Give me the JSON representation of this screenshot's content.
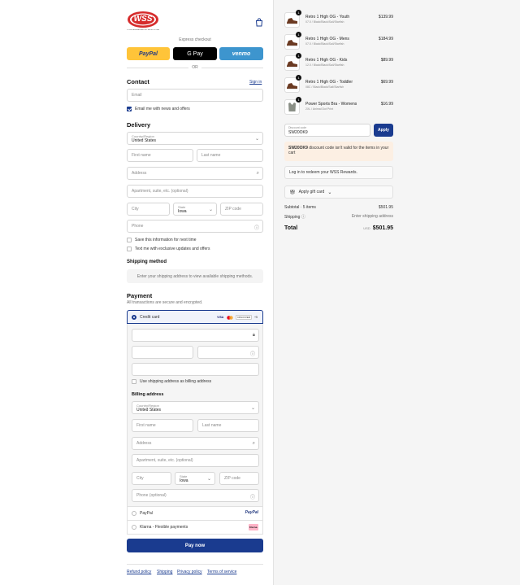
{
  "header": {
    "logo_text": "WSS",
    "logo_tagline": "YOUR NEIGHBORHOOD SHOE STORE"
  },
  "express": {
    "label": "Express checkout",
    "paypal": "PayPal",
    "gpay": "G Pay",
    "venmo": "venmo",
    "or": "OR"
  },
  "contact": {
    "title": "Contact",
    "sign_in": "Sign in",
    "email_placeholder": "Email",
    "news_label": "Email me with news and offers",
    "news_checked": true
  },
  "delivery": {
    "title": "Delivery",
    "country_label": "Country/Region",
    "country_value": "United States",
    "first_name": "First name",
    "last_name": "Last name",
    "address": "Address",
    "apartment": "Apartment, suite, etc. (optional)",
    "city": "City",
    "state_label": "State",
    "state_value": "Iowa",
    "zip": "ZIP code",
    "phone": "Phone",
    "save_info": "Save this information for next time",
    "text_me": "Text me with exclusive updates and offers"
  },
  "shipping": {
    "title": "Shipping method",
    "placeholder": "Enter your shipping address to view available shipping methods."
  },
  "payment": {
    "title": "Payment",
    "subtitle": "All transactions are secure and encrypted.",
    "credit_card": "Credit card",
    "card_brands": [
      "VISA",
      "MC",
      "DISCOVER",
      "+5"
    ],
    "use_shipping": "Use shipping address as billing address",
    "paypal": "PayPal",
    "klarna": "Klarna - Flexible payments",
    "klarna_badge": "Klarna."
  },
  "billing": {
    "title": "Billing address",
    "country_label": "Country/Region",
    "country_value": "United States",
    "first_name": "First name",
    "last_name": "Last name",
    "address": "Address",
    "apartment": "Apartment, suite, etc. (optional)",
    "city": "City",
    "state_label": "State",
    "state_value": "Iowa",
    "zip": "ZIP code",
    "phone": "Phone (optional)"
  },
  "pay_now": "Pay now",
  "footer": {
    "refund": "Refund policy",
    "shipping": "Shipping",
    "privacy": "Privacy policy",
    "terms": "Terms of service"
  },
  "cart": {
    "items": [
      {
        "name": "Retro 1 High OG - Youth",
        "variant": "07.0 / Black/Black/Sail/Starfish",
        "price": "$139.99",
        "qty": "1"
      },
      {
        "name": "Retro 1 High OG - Mens",
        "variant": "07.0 / Black/Black/Sail/Starfish",
        "price": "$184.99",
        "qty": "1"
      },
      {
        "name": "Retro 1 High OG - Kids",
        "variant": "12.0 / Black/Black/Sail/Starfish",
        "price": "$89.99",
        "qty": "1"
      },
      {
        "name": "Retro 1 High OG - Toddler",
        "variant": "08C / Black/Black/Sail/Starfish",
        "price": "$69.99",
        "qty": "1"
      },
      {
        "name": "Power Sports Bra - Womens",
        "variant": "2XL / Animal Dot Print",
        "price": "$16.99",
        "qty": "1"
      }
    ],
    "discount_label": "Discount code",
    "discount_value": "SW20OK9",
    "apply": "Apply",
    "warn_code": "SW20OK9",
    "warn_text": "discount code isn't valid for the items in your cart",
    "rewards": "Log in to redeem your WSS Rewards.",
    "gift": "Apply gift card",
    "subtotal_label": "Subtotal · 5 items",
    "subtotal_value": "$501.95",
    "shipping_label": "Shipping",
    "shipping_value": "Enter shipping address",
    "total_label": "Total",
    "currency": "USD",
    "total_value": "$501.95"
  },
  "colors": {
    "accent": "#1a3b8f",
    "paypal": "#ffc439",
    "venmo": "#3d95ce",
    "logo_red": "#d62b2b"
  }
}
